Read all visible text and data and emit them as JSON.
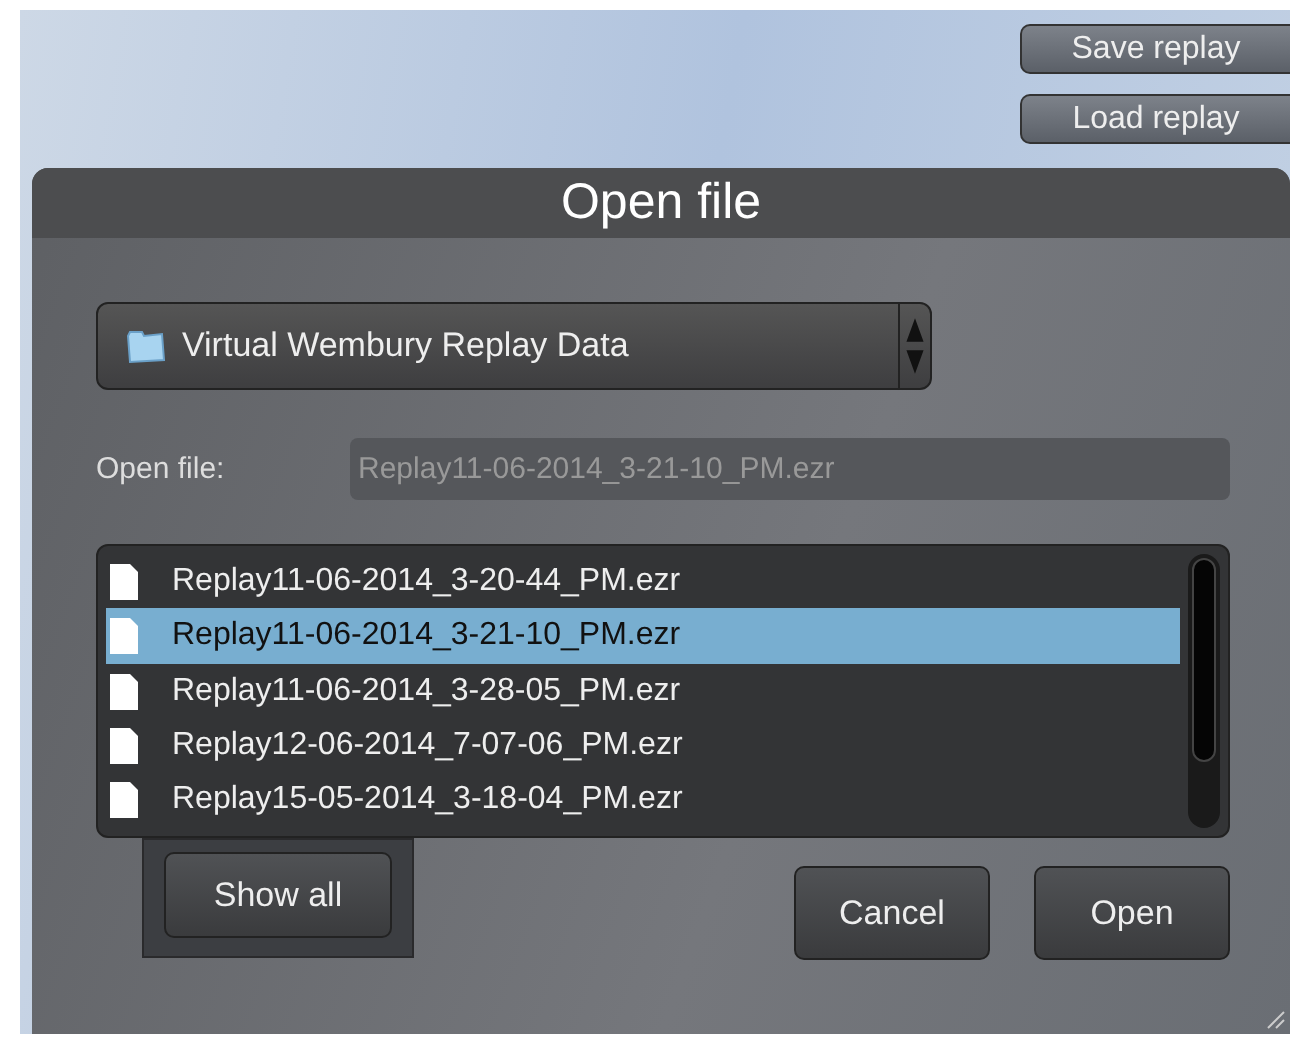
{
  "top_buttons": [
    "Save replay",
    "Load replay"
  ],
  "dialog": {
    "title": "Open file",
    "folder_dropdown": {
      "value": "Virtual Wembury Replay Data"
    },
    "open_file": {
      "label": "Open file:",
      "value": "Replay11-06-2014_3-21-10_PM.ezr"
    },
    "files": [
      {
        "name": "Replay11-06-2014_3-20-44_PM.ezr",
        "selected": false
      },
      {
        "name": "Replay11-06-2014_3-21-10_PM.ezr",
        "selected": true
      },
      {
        "name": "Replay11-06-2014_3-28-05_PM.ezr",
        "selected": false
      },
      {
        "name": "Replay12-06-2014_7-07-06_PM.ezr",
        "selected": false
      },
      {
        "name": "Replay15-05-2014_3-18-04_PM.ezr",
        "selected": false
      }
    ],
    "show_all_button": "Show all",
    "buttons": [
      "Cancel",
      "Open"
    ]
  }
}
